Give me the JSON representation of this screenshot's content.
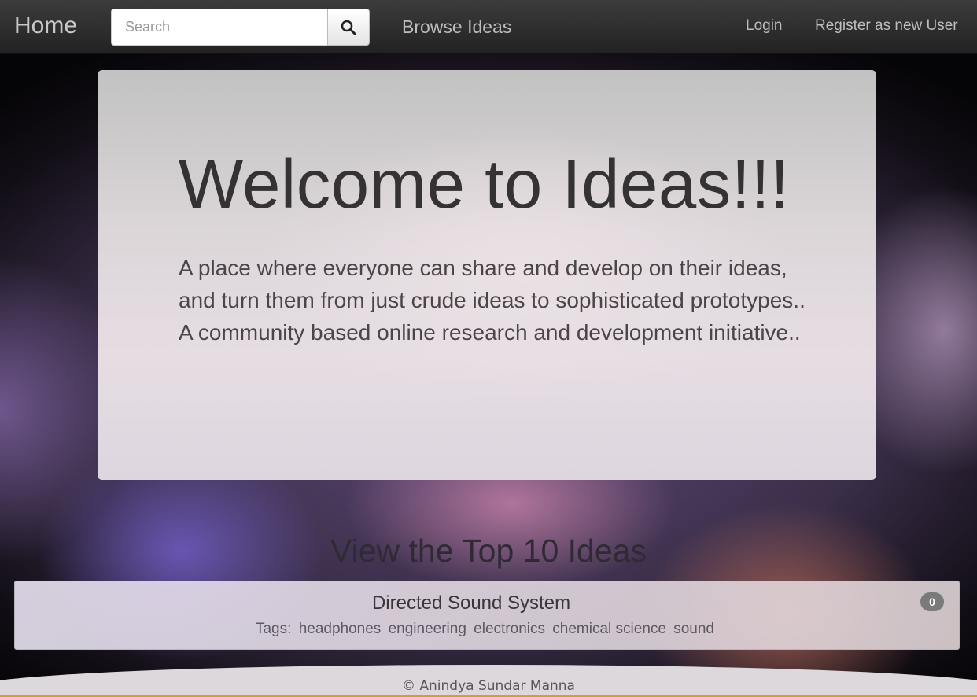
{
  "navbar": {
    "brand": "Home",
    "search": {
      "placeholder": "Search",
      "value": ""
    },
    "search_button_icon": "search-icon",
    "browse_link": "Browse Ideas",
    "login_link": "Login",
    "register_link": "Register as new User"
  },
  "jumbotron": {
    "title": "Welcome to Ideas!!!",
    "paragraph_1": "A place where everyone can share and develop on their ideas, and turn them from just crude ideas to sophisticated prototypes..",
    "paragraph_2": "A community based online research and development initiative.."
  },
  "top_ideas": {
    "heading": "View the Top 10 Ideas",
    "items": [
      {
        "title": "Directed Sound System",
        "tags_label": "Tags:",
        "tags": [
          "headphones",
          "engineering",
          "electronics",
          "chemical science",
          "sound"
        ],
        "count": "0"
      }
    ]
  },
  "footer": {
    "text": "© Anindya Sundar Manna"
  },
  "colors": {
    "navbar": "#2a2a2a",
    "badge": "#7a7a7a",
    "footer_accent": "#c9a23a"
  }
}
